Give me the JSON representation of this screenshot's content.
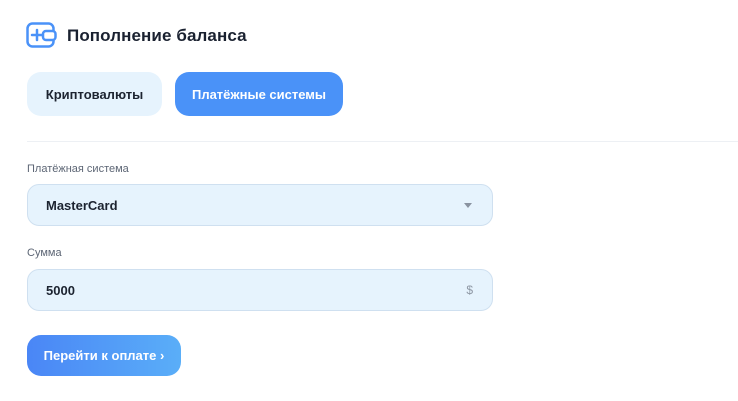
{
  "header": {
    "title": "Пополнение баланса",
    "icon": "wallet-plus-icon"
  },
  "tabs": [
    {
      "label": "Криптовалюты",
      "active": false
    },
    {
      "label": "Платёжные системы",
      "active": true
    }
  ],
  "form": {
    "payment_system": {
      "label": "Платёжная система",
      "value": "MasterCard",
      "icon": "chevron-down-icon"
    },
    "amount": {
      "label": "Сумма",
      "value": "5000",
      "currency_symbol": "$"
    },
    "submit_label": "Перейти к оплате ›"
  },
  "colors": {
    "accent": "#4a92f8",
    "field_background": "#e6f3fd",
    "text_primary": "#1c2330",
    "text_secondary": "#5d6675"
  }
}
